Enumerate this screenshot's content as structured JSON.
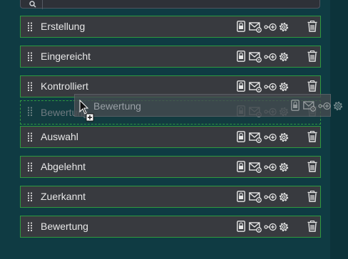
{
  "search": {
    "placeholder": ""
  },
  "rows": [
    {
      "label": "Erstellung"
    },
    {
      "label": "Eingereicht"
    },
    {
      "label": "Kontrolliert"
    },
    {
      "label": "Auswahl"
    },
    {
      "label": "Abgelehnt"
    },
    {
      "label": "Zuerkannt"
    },
    {
      "label": "Bewertung"
    }
  ],
  "drag": {
    "placeholder_label": "Bewertung",
    "preview_label": "Bewertung"
  },
  "icons": {
    "handle": "drag-handle-icon",
    "lock": "lock-icon",
    "mail": "mail-settings-icon",
    "link": "link-add-icon",
    "gear": "gear-icon",
    "trash": "trash-icon"
  },
  "colors": {
    "background": "#0f3b43",
    "row": "#383a3f",
    "row_border": "#2f9a3f",
    "text": "#e8e8e8"
  }
}
